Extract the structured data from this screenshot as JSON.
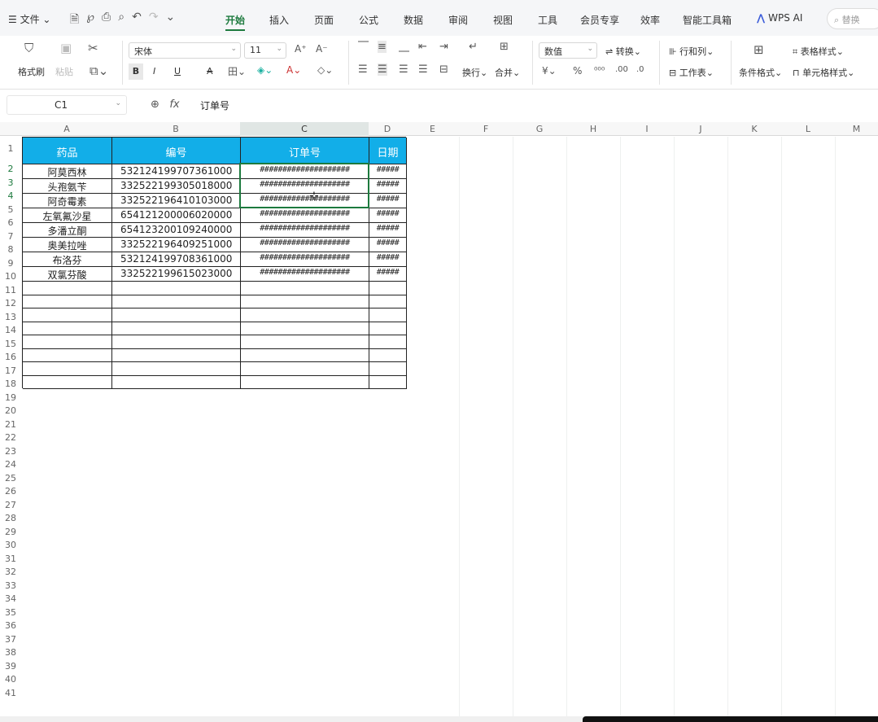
{
  "menubar": {
    "file_label": "☰ 文件 ⌄",
    "tabs": [
      "开始",
      "插入",
      "页面",
      "公式",
      "数据",
      "审阅",
      "视图",
      "工具",
      "会员专享",
      "效率",
      "智能工具箱"
    ],
    "active_tab": "开始",
    "wps_ai": "WPS AI",
    "search_placeholder": "替换"
  },
  "ribbon": {
    "format_painter": "格式刷",
    "paste": "粘贴",
    "font_name": "宋体",
    "font_size": "11",
    "bold": "B",
    "italic": "I",
    "underline": "U",
    "strike": "A",
    "wrap": "换行",
    "merge": "合并",
    "number_format": "数值",
    "convert": "转换",
    "row_col": "行和列",
    "worksheet": "工作表",
    "cond_format": "条件格式",
    "table_style": "表格样式",
    "cell_style": "单元格样式"
  },
  "formula_bar": {
    "cell_ref": "C1",
    "fx": "fx",
    "value": "订单号"
  },
  "columns": [
    "A",
    "B",
    "C",
    "D",
    "E",
    "F",
    "G",
    "H",
    "I",
    "J",
    "K",
    "L",
    "M"
  ],
  "selected_column": "C",
  "table": {
    "headers": [
      "药品",
      "编号",
      "订单号",
      "日期"
    ],
    "rows": [
      [
        "阿莫西林",
        "532124199707361000",
        "####################",
        "#####"
      ],
      [
        "头孢氨苄",
        "332522199305018000",
        "####################",
        "#####"
      ],
      [
        "阿奇霉素",
        "332522196410103000",
        "####################",
        "#####"
      ],
      [
        "左氧氟沙星",
        "654121200006020000",
        "####################",
        "#####"
      ],
      [
        "多潘立酮",
        "654123200109240000",
        "####################",
        "#####"
      ],
      [
        "奥美拉唑",
        "332522196409251000",
        "####################",
        "#####"
      ],
      [
        "布洛芬",
        "532124199708361000",
        "####################",
        "#####"
      ],
      [
        "双氯芬酸",
        "332522199615023000",
        "####################",
        "#####"
      ]
    ],
    "empty_rows": 8
  },
  "row_count": 41
}
